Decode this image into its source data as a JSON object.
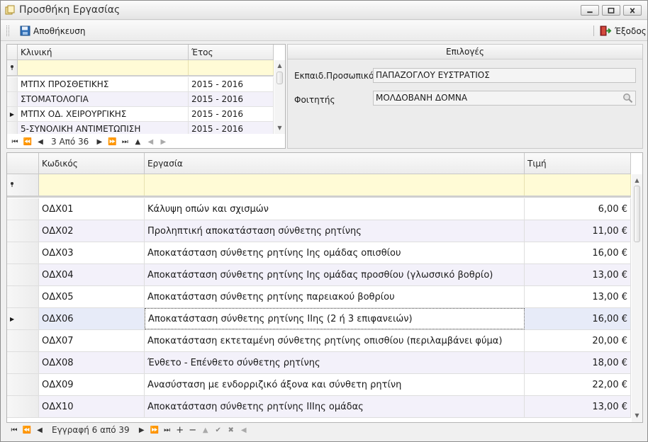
{
  "window": {
    "title": "Προσθήκη Εργασίας"
  },
  "toolbar": {
    "save_label": "Αποθήκευση",
    "exit_label": "Έξοδος"
  },
  "top_grid": {
    "columns": [
      "Κλινική",
      "Έτος"
    ],
    "rows": [
      {
        "clinic": "ΜΤΠΧ ΠΡΟΣΘΕΤΙΚΗΣ",
        "year": "2015 - 2016"
      },
      {
        "clinic": "ΣΤΟΜΑΤΟΛΟΓΙΑ",
        "year": "2015 - 2016"
      },
      {
        "clinic": "ΜΤΠΧ ΟΔ. ΧΕΙΡΟΥΡΓΙΚΗΣ",
        "year": "2015 - 2016"
      },
      {
        "clinic": "5-ΣΥΝΟΛΙΚΗ ΑΝΤΙΜΕΤΩΠΙΣΗ",
        "year": "2015 - 2016"
      }
    ],
    "selected_index": 2,
    "nav_text": "3 Από 36"
  },
  "options": {
    "header": "Επιλογές",
    "staff_label": "Εκπαιδ.Προσωπικό",
    "staff_value": "ΠΑΠΑΖΟΓΛΟΥ ΕΥΣΤΡΑΤΙΟΣ",
    "student_label": "Φοιτητής",
    "student_value": "ΜΟΛΔΟΒΑΝΗ  ΔΟΜΝΑ"
  },
  "main_grid": {
    "columns": [
      "Κωδικός",
      "Εργασία",
      "Τιμή"
    ],
    "rows": [
      {
        "code": "ΟΔΧ01",
        "task": "Κάλυψη οπών και σχισμών",
        "price": "6,00 €"
      },
      {
        "code": "ΟΔΧ02",
        "task": "Προληπτική αποκατάσταση σύνθετης ρητίνης",
        "price": "11,00 €"
      },
      {
        "code": "ΟΔΧ03",
        "task": "Αποκατάσταση σύνθετης ρητίνης Ιης ομάδας οπισθίου",
        "price": "16,00 €"
      },
      {
        "code": "ΟΔΧ04",
        "task": "Αποκατάσταση σύνθετης ρητίνης Ιης ομάδας προσθίου (γλωσσικό βοθρίο)",
        "price": "13,00 €"
      },
      {
        "code": "ΟΔΧ05",
        "task": "Αποκατάσταση σύνθετης ρητίνης παρειακού βοθρίου",
        "price": "13,00 €"
      },
      {
        "code": "ΟΔΧ06",
        "task": "Αποκατάσταση σύνθετης ρητίνης ΙΙης (2 ή 3 επιφανειών)",
        "price": "16,00 €"
      },
      {
        "code": "ΟΔΧ07",
        "task": "Αποκατάσταση εκτεταμένη σύνθετης ρητίνης οπισθίου (περιλαμβάνει φύμα)",
        "price": "20,00 €"
      },
      {
        "code": "ΟΔΧ08",
        "task": "Ένθετο - Επένθετο σύνθετης ρητίνης",
        "price": "18,00 €"
      },
      {
        "code": "ΟΔΧ09",
        "task": "Ανασύσταση με ενδορριζικό άξονα και σύνθετη ρητίνη",
        "price": "22,00 €"
      },
      {
        "code": "ΟΔΧ10",
        "task": "Αποκατάσταση σύνθετης ρητίνης ΙΙΙης ομάδας",
        "price": "13,00 €"
      }
    ],
    "selected_index": 5,
    "nav_text": "Εγγραφή 6 από 39"
  },
  "icons": {
    "app": "app-window-icon",
    "save": "floppy-disk-icon",
    "exit": "exit-door-icon",
    "search": "magnifier-icon",
    "filter": "pin-icon",
    "row_pointer": "row-pointer-icon"
  },
  "colors": {
    "filter_row": "#fffbd6",
    "alt_row": "#f3f1fa",
    "selected_row": "#e7ebf8"
  }
}
